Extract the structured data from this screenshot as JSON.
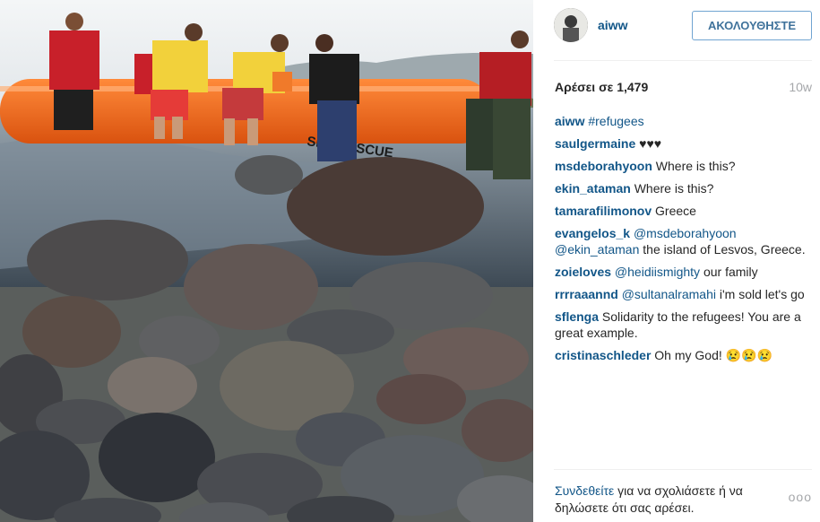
{
  "post": {
    "username": "aiww",
    "follow_label": "ΑΚΟΛΟΥΘΗΣΤΕ",
    "likes_label": "Αρέσει σε 1,479",
    "time_ago": "10w",
    "boat_text": "SEA RESCUE"
  },
  "comments": [
    {
      "user": "aiww",
      "mention": "",
      "text": "#refugees"
    },
    {
      "user": "saulgermaine",
      "mention": "",
      "text": "♥♥♥"
    },
    {
      "user": "msdeborahyoon",
      "mention": "",
      "text": "Where is this?"
    },
    {
      "user": "ekin_ataman",
      "mention": "",
      "text": "Where is this?"
    },
    {
      "user": "tamarafilimonov",
      "mention": "",
      "text": "Greece"
    },
    {
      "user": "evangelos_k",
      "mention": "@msdeborahyoon @ekin_ataman",
      "text": "the island of Lesvos, Greece."
    },
    {
      "user": "zoieloves",
      "mention": "@heidiismighty",
      "text": "our family"
    },
    {
      "user": "rrrraaannd",
      "mention": "@sultanalramahi",
      "text": "i'm sold let's go"
    },
    {
      "user": "sflenga",
      "mention": "",
      "text": "Solidarity to the refugees! You are a great example."
    },
    {
      "user": "cristinaschleder",
      "mention": "",
      "text": "Oh my God! 😢😢😢"
    }
  ],
  "footer": {
    "login_link": "Συνδεθείτε",
    "prompt_text": "για να σχολιάσετε ή να δηλώσετε ότι σας αρέσει.",
    "more_icon": "ooo"
  },
  "colors": {
    "link_blue": "#125688",
    "follow_border": "#70a4d1",
    "boat_orange": "#f06a1f"
  }
}
